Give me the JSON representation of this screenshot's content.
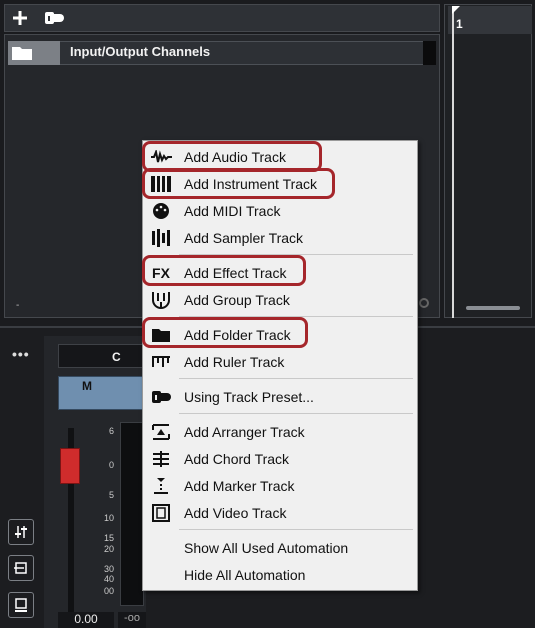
{
  "project": {
    "toolbar": {
      "add_icon": "plus-icon",
      "preset_icon": "add-track-preset-icon"
    },
    "io_track": {
      "label": "Input/Output Channels",
      "icon": "folder-icon"
    },
    "ruler": {
      "bar_number": "1"
    },
    "corner_mark": "-"
  },
  "mixer": {
    "dots": "•••",
    "channel_name": "C",
    "mute_label": "M",
    "scale": [
      "6",
      "0",
      "5",
      "10",
      "15",
      "20",
      "30",
      "40",
      "00"
    ],
    "volume": "0.00",
    "peak": "-oo",
    "side_buttons": [
      "mixer-settings-icon",
      "routing-icon",
      "monitor-icon"
    ]
  },
  "menu": {
    "items": [
      {
        "label": "Add Audio Track",
        "icon": "audio-waveform-icon",
        "highlighted": true
      },
      {
        "label": "Add Instrument Track",
        "icon": "piano-keys-icon",
        "highlighted": true
      },
      {
        "label": "Add MIDI Track",
        "icon": "midi-plug-icon",
        "highlighted": false
      },
      {
        "label": "Add Sampler Track",
        "icon": "sampler-icon",
        "highlighted": false
      },
      {
        "label": "Add Effect Track",
        "icon": "fx-icon",
        "highlighted": true
      },
      {
        "label": "Add Group Track",
        "icon": "group-icon",
        "highlighted": false
      },
      {
        "label": "Add Folder Track",
        "icon": "folder-icon",
        "highlighted": true
      },
      {
        "label": "Add Ruler Track",
        "icon": "ruler-icon",
        "highlighted": false
      },
      {
        "label": "Using Track Preset...",
        "icon": "track-preset-icon",
        "highlighted": false
      },
      {
        "label": "Add Arranger Track",
        "icon": "arranger-icon",
        "highlighted": false
      },
      {
        "label": "Add Chord Track",
        "icon": "chord-icon",
        "highlighted": false
      },
      {
        "label": "Add Marker Track",
        "icon": "marker-icon",
        "highlighted": false
      },
      {
        "label": "Add Video Track",
        "icon": "video-icon",
        "highlighted": false
      },
      {
        "label": "Show All Used Automation",
        "icon": "",
        "highlighted": false
      },
      {
        "label": "Hide All Automation",
        "icon": "",
        "highlighted": false
      }
    ],
    "fx_glyph": "FX"
  },
  "colors": {
    "highlight_outline": "#a5262b",
    "menu_bg": "#f0f0f0",
    "fader_red": "#cf2c2c",
    "ms_blue": "#6f8faf"
  }
}
